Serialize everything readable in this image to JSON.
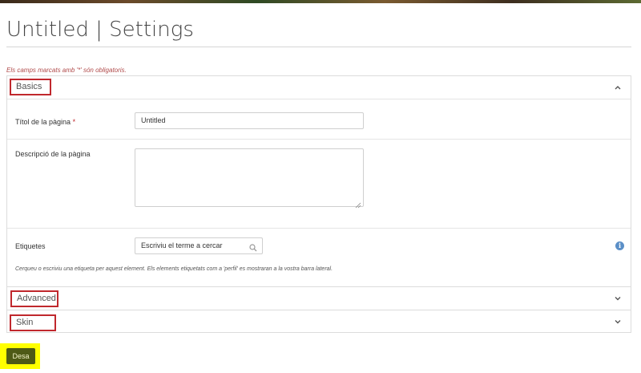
{
  "header": {
    "title": "Untitled | Settings",
    "required_note": "Els camps marcats amb '*' són obligatoris."
  },
  "sections": {
    "basics": {
      "label": "Basics",
      "expanded": true
    },
    "advanced": {
      "label": "Advanced",
      "expanded": false
    },
    "skin": {
      "label": "Skin",
      "expanded": false
    }
  },
  "form": {
    "title_label": "Títol de la pàgina",
    "title_required_mark": "*",
    "title_value": "Untitled",
    "description_label": "Descripció de la pàgina",
    "description_value": "",
    "tags_label": "Etiquetes",
    "tags_placeholder": "Escriviu el terme a cercar",
    "tags_help": "Cerqueu o escriviu una etiqueta per aquest element. Els elements etiquetats com a 'perfil' es mostraran a la vostra barra lateral."
  },
  "actions": {
    "save_label": "Desa"
  },
  "icons": {
    "collapse": "chevron-up-icon",
    "expand": "chevron-down-icon",
    "search": "search-icon",
    "info": "info-icon"
  },
  "colors": {
    "highlight_box": "#c0282d",
    "save_button": "#4e5a16",
    "save_highlight": "#ffff00",
    "info": "#5b8fc7"
  }
}
